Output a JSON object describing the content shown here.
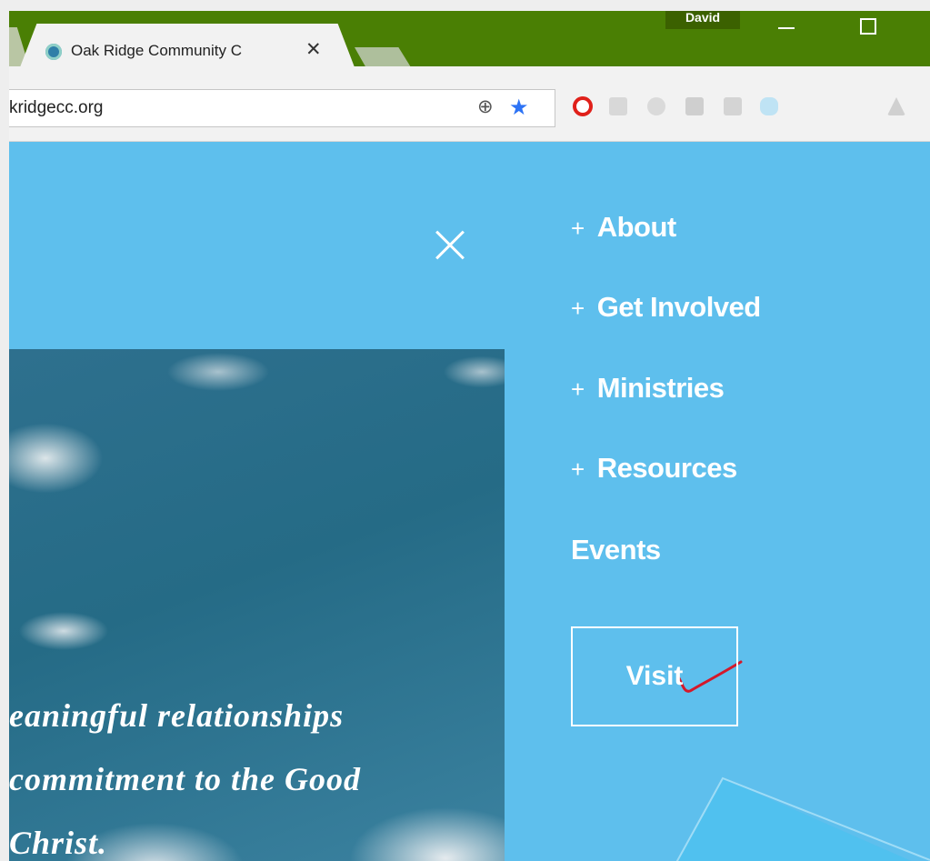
{
  "browser": {
    "tab_title": "Oak Ridge Community C",
    "tab_close": "✕",
    "profile_name": "David",
    "url": "kridgecc.org"
  },
  "nav": {
    "items": [
      {
        "prefix": "+",
        "label": "About"
      },
      {
        "prefix": "+",
        "label": "Get Involved"
      },
      {
        "prefix": "+",
        "label": "Ministries"
      },
      {
        "prefix": "+",
        "label": "Resources"
      },
      {
        "prefix": "",
        "label": "Events"
      }
    ],
    "visit_label": "Visit"
  },
  "hero": {
    "lines": [
      "eaningful relationships",
      "commitment to the Good",
      "Christ."
    ]
  },
  "icons": {
    "zoom": "zoom-icon",
    "star": "bookmark-star-icon",
    "close": "close-menu-icon",
    "check": "red-checkmark-annotation"
  },
  "colors": {
    "titlebar": "#4a7f04",
    "site_background": "#5ebfed",
    "bookmark_star": "#2d73f5",
    "annotation": "#d4182a"
  }
}
